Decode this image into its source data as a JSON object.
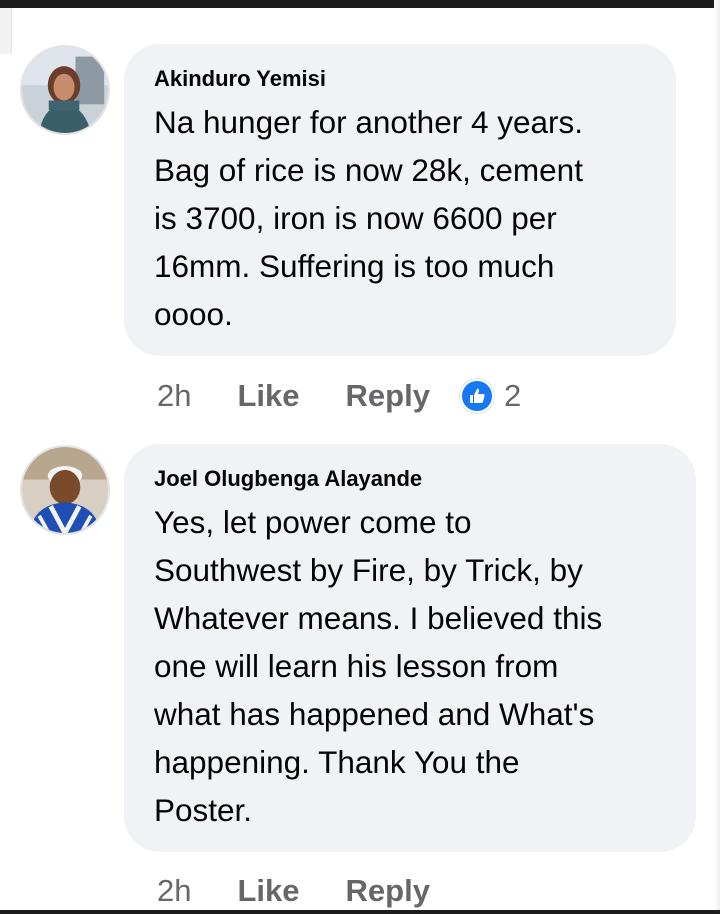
{
  "comments": [
    {
      "author": "Akinduro Yemisi",
      "text": "Na hunger for another 4 years.\nBag of rice is now 28k, cement\nis 3700, iron is now 6600 per\n16mm. Suffering is too much\noooo.",
      "time": "2h",
      "like_label": "Like",
      "reply_label": "Reply",
      "reaction_count": "2",
      "reaction_icon": "thumbs-up-icon"
    },
    {
      "author": "Joel Olugbenga Alayande",
      "text": "Yes, let power come to\nSouthwest by Fire, by Trick, by\nWhatever means. I believed this\none will learn his lesson from\nwhat has happened and What's\nhappening. Thank You the\nPoster.",
      "time": "2h",
      "like_label": "Like",
      "reply_label": "Reply"
    }
  ],
  "colors": {
    "bubble": "#f0f2f5",
    "meta_text": "#65676b",
    "reaction_blue": "#1877f2"
  }
}
